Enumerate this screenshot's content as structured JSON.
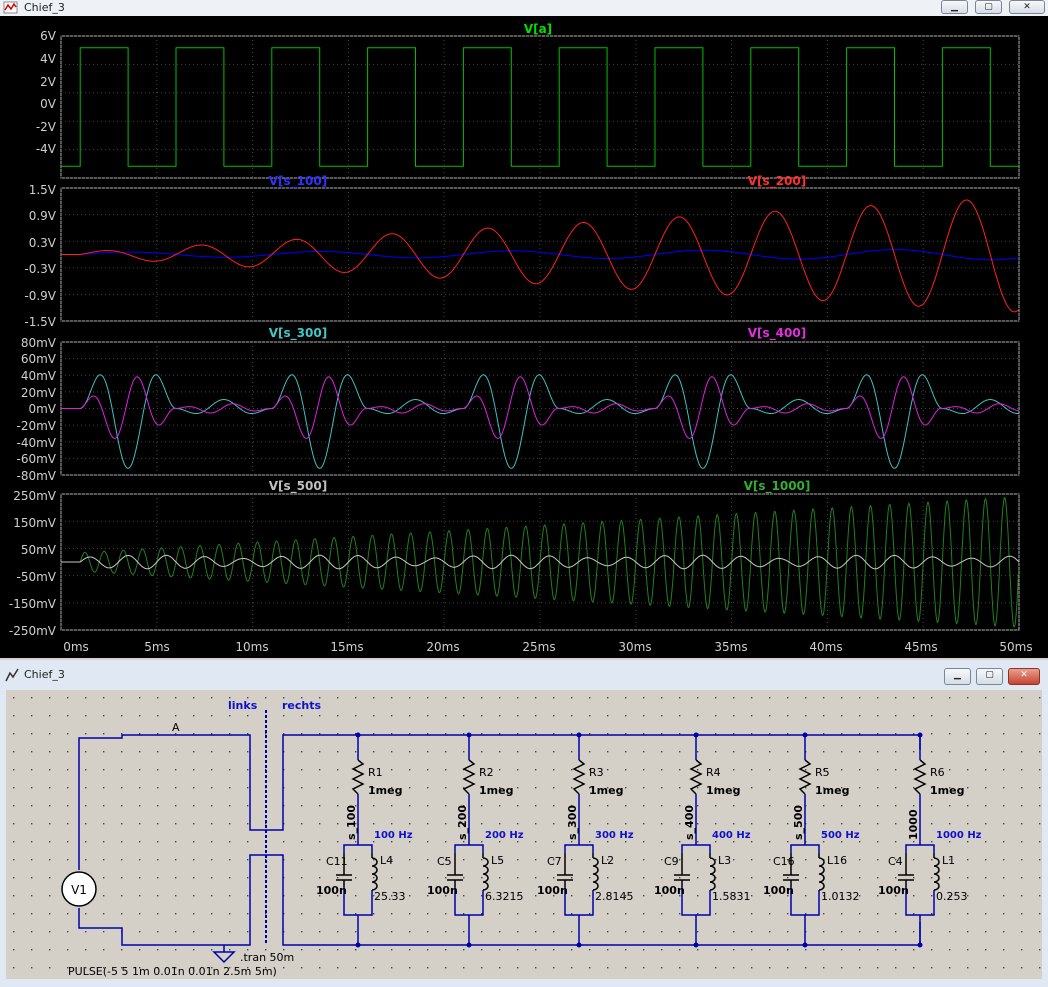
{
  "top_window": {
    "title": "Chief_3",
    "buttons": [
      "minimize",
      "maximize",
      "close"
    ]
  },
  "schematic_window": {
    "title": "Chief_3",
    "buttons": [
      "minimize",
      "maximize",
      "close"
    ]
  },
  "colors": {
    "plot_bg": "#000000",
    "grid": "#444444",
    "axis_text": "#cfcfcf",
    "green_trace": "#00c000",
    "blue_trace": "#0000ff",
    "red_trace": "#ff2020",
    "cyan_trace": "#40c0c0",
    "magenta_trace": "#e020e0",
    "white_trace": "#c8c8c8",
    "dark_green_trace": "#208020",
    "wire": "#0000aa",
    "label_blue": "#1010cc"
  },
  "chart_data": [
    {
      "type": "line",
      "pane": 1,
      "x_range_ms": [
        0,
        50
      ],
      "y_ticks": [
        "6V",
        "4V",
        "2V",
        "0V",
        "-2V",
        "-4V"
      ],
      "ylim": [
        -6,
        6
      ],
      "series": [
        {
          "name": "V[a]",
          "waveform": "square",
          "low": -5,
          "high": 5,
          "delay_ms": 1,
          "on_ms": 2.5,
          "period_ms": 5
        }
      ]
    },
    {
      "type": "line",
      "pane": 2,
      "x_range_ms": [
        0,
        50
      ],
      "y_ticks": [
        "1.5V",
        "0.9V",
        "0.3V",
        "-0.3V",
        "-0.9V",
        "-1.5V"
      ],
      "ylim": [
        -1.5,
        1.5
      ],
      "series": [
        {
          "name": "V[s_100]",
          "frequency_hz": 100,
          "amplitude_start": 0.05,
          "amplitude_end": 0.12
        },
        {
          "name": "V[s_200]",
          "frequency_hz": 200,
          "amplitude_start": 0.03,
          "amplitude_end": 1.3
        }
      ]
    },
    {
      "type": "line",
      "pane": 3,
      "x_range_ms": [
        0,
        50
      ],
      "y_ticks": [
        "80mV",
        "60mV",
        "40mV",
        "20mV",
        "0mV",
        "-20mV",
        "-40mV",
        "-60mV",
        "-80mV"
      ],
      "ylim": [
        -80,
        80
      ],
      "series": [
        {
          "name": "V[s_300]",
          "peak_mV": 72
        },
        {
          "name": "V[s_400]",
          "peak_mV": 40
        }
      ]
    },
    {
      "type": "line",
      "pane": 4,
      "x_range_ms": [
        0,
        50
      ],
      "y_ticks": [
        "250mV",
        "150mV",
        "50mV",
        "-50mV",
        "-150mV",
        "-250mV"
      ],
      "ylim": [
        -250,
        250
      ],
      "x_ticks": [
        "0ms",
        "5ms",
        "10ms",
        "15ms",
        "20ms",
        "25ms",
        "30ms",
        "35ms",
        "40ms",
        "45ms",
        "50ms"
      ],
      "series": [
        {
          "name": "V[s_500]",
          "frequency_hz": 500,
          "amplitude_mV": 25
        },
        {
          "name": "V[s_1000]",
          "frequency_hz": 1000,
          "amplitude_start_mV": 30,
          "amplitude_end_mV": 240
        }
      ]
    }
  ],
  "schematic": {
    "node_a": "A",
    "transformer_left": "links",
    "transformer_right": "rechts",
    "source": "V1",
    "pulse": "PULSE(-5 5 1m 0.01n 0.01n 2.5m 5m)",
    "tran": ".tran 50m",
    "resistor_value": "1meg",
    "branches": [
      {
        "node": "s_100",
        "freq": "100 Hz",
        "resistor": "R1",
        "cap": "C11",
        "cap_value": "100n",
        "ind": "L4",
        "ind_value": "25.33"
      },
      {
        "node": "s_200",
        "freq": "200 Hz",
        "resistor": "R2",
        "cap": "C5",
        "cap_value": "100n",
        "ind": "L5",
        "ind_value": "6.3215"
      },
      {
        "node": "s_300",
        "freq": "300 Hz",
        "resistor": "R3",
        "cap": "C7",
        "cap_value": "100n",
        "ind": "L2",
        "ind_value": "2.8145"
      },
      {
        "node": "s_400",
        "freq": "400 Hz",
        "resistor": "R4",
        "cap": "C9",
        "cap_value": "100n",
        "ind": "L3",
        "ind_value": "1.5831"
      },
      {
        "node": "s_500",
        "freq": "500 Hz",
        "resistor": "R5",
        "cap": "C16",
        "cap_value": "100n",
        "ind": "L16",
        "ind_value": "1.0132"
      },
      {
        "node": "1000",
        "freq": "1000 Hz",
        "resistor": "R6",
        "cap": "C4",
        "cap_value": "100n",
        "ind": "L1",
        "ind_value": "0.253"
      }
    ]
  }
}
